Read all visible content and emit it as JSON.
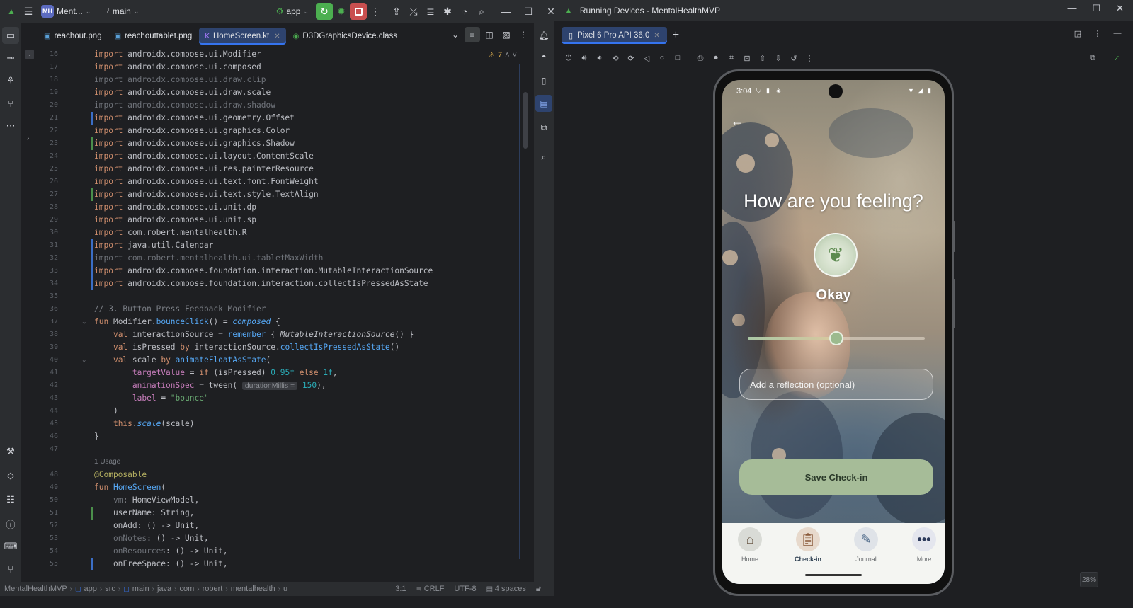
{
  "ide": {
    "project_badge": "MH",
    "project_name": "Ment...",
    "branch": "main",
    "run_config": "app",
    "tabs": [
      {
        "label": "reachout.png",
        "icon": "image-icon"
      },
      {
        "label": "reachouttablet.png",
        "icon": "image-icon"
      },
      {
        "label": "HomeScreen.kt",
        "icon": "kotlin-file-icon",
        "active": true
      },
      {
        "label": "D3DGraphicsDevice.class",
        "icon": "class-file-icon"
      }
    ],
    "warnings_count": "7",
    "usage_hint": "1 Usage",
    "status": {
      "crumbs": [
        "MentalHealthMVP",
        "app",
        "src",
        "main",
        "java",
        "com",
        "robert",
        "mentalhealth",
        "u"
      ],
      "position": "3:1",
      "line_ending": "CRLF",
      "encoding": "UTF-8",
      "indent": "4 spaces"
    }
  },
  "code_lines": [
    {
      "n": "16",
      "t": "import androidx.compose.ui.Modifier"
    },
    {
      "n": "17",
      "t": "import androidx.compose.ui.composed"
    },
    {
      "n": "18",
      "t": "import androidx.compose.ui.draw.clip"
    },
    {
      "n": "19",
      "t": "import androidx.compose.ui.draw.scale"
    },
    {
      "n": "20",
      "t": "import androidx.compose.ui.draw.shadow"
    },
    {
      "n": "21",
      "t": "import androidx.compose.ui.geometry.Offset"
    },
    {
      "n": "22",
      "t": "import androidx.compose.ui.graphics.Color"
    },
    {
      "n": "23",
      "t": "import androidx.compose.ui.graphics.Shadow"
    },
    {
      "n": "24",
      "t": "import androidx.compose.ui.layout.ContentScale"
    },
    {
      "n": "25",
      "t": "import androidx.compose.ui.res.painterResource"
    },
    {
      "n": "26",
      "t": "import androidx.compose.ui.text.font.FontWeight"
    },
    {
      "n": "27",
      "t": "import androidx.compose.ui.text.style.TextAlign"
    },
    {
      "n": "28",
      "t": "import androidx.compose.ui.unit.dp"
    },
    {
      "n": "29",
      "t": "import androidx.compose.ui.unit.sp"
    },
    {
      "n": "30",
      "t": "import com.robert.mentalhealth.R"
    },
    {
      "n": "31",
      "t": "import java.util.Calendar"
    },
    {
      "n": "32",
      "t": "import com.robert.mentalhealth.ui.tabletMaxWidth"
    },
    {
      "n": "33",
      "t": "import androidx.compose.foundation.interaction.MutableInteractionSource"
    },
    {
      "n": "34",
      "t": "import androidx.compose.foundation.interaction.collectIsPressedAsState"
    },
    {
      "n": "35",
      "t": ""
    },
    {
      "n": "36",
      "t": "// 3. Button Press Feedback Modifier"
    },
    {
      "n": "37",
      "t": "fun Modifier.bounceClick() = composed {"
    },
    {
      "n": "38",
      "t": "    val interactionSource = remember { MutableInteractionSource() }"
    },
    {
      "n": "39",
      "t": "    val isPressed by interactionSource.collectIsPressedAsState()"
    },
    {
      "n": "40",
      "t": "    val scale by animateFloatAsState("
    },
    {
      "n": "41",
      "t": "        targetValue = if (isPressed) 0.95f else 1f,"
    },
    {
      "n": "42",
      "t": "        animationSpec = tween( durationMillis = 150),"
    },
    {
      "n": "43",
      "t": "        label = \"bounce\""
    },
    {
      "n": "44",
      "t": "    )"
    },
    {
      "n": "45",
      "t": "    this.scale(scale)"
    },
    {
      "n": "46",
      "t": "}"
    },
    {
      "n": "47",
      "t": ""
    },
    {
      "n": "48",
      "t": "@Composable"
    },
    {
      "n": "49",
      "t": "fun HomeScreen("
    },
    {
      "n": "50",
      "t": "    vm: HomeViewModel,"
    },
    {
      "n": "51",
      "t": "    userName: String,"
    },
    {
      "n": "52",
      "t": "    onAdd: () -> Unit,"
    },
    {
      "n": "53",
      "t": "    onNotes: () -> Unit,"
    },
    {
      "n": "54",
      "t": "    onResources: () -> Unit,"
    },
    {
      "n": "55",
      "t": "    onFreeSpace: () -> Unit,"
    }
  ],
  "device_panel": {
    "title": "Running Devices - MentalHealthMVP",
    "device_tab": "Pixel 6 Pro API 36.0",
    "zoom": "28%"
  },
  "app": {
    "status_time": "3:04",
    "heading": "How are you feeling?",
    "mood_label": "Okay",
    "mood_level": 0.5,
    "reflection_placeholder": "Add a reflection (optional)",
    "save_label": "Save Check-in",
    "nav": [
      {
        "label": "Home",
        "icon": "house-icon"
      },
      {
        "label": "Check-in",
        "icon": "clipboard-icon",
        "active": true
      },
      {
        "label": "Journal",
        "icon": "journal-icon"
      },
      {
        "label": "More",
        "icon": "more-dots-icon"
      }
    ]
  }
}
